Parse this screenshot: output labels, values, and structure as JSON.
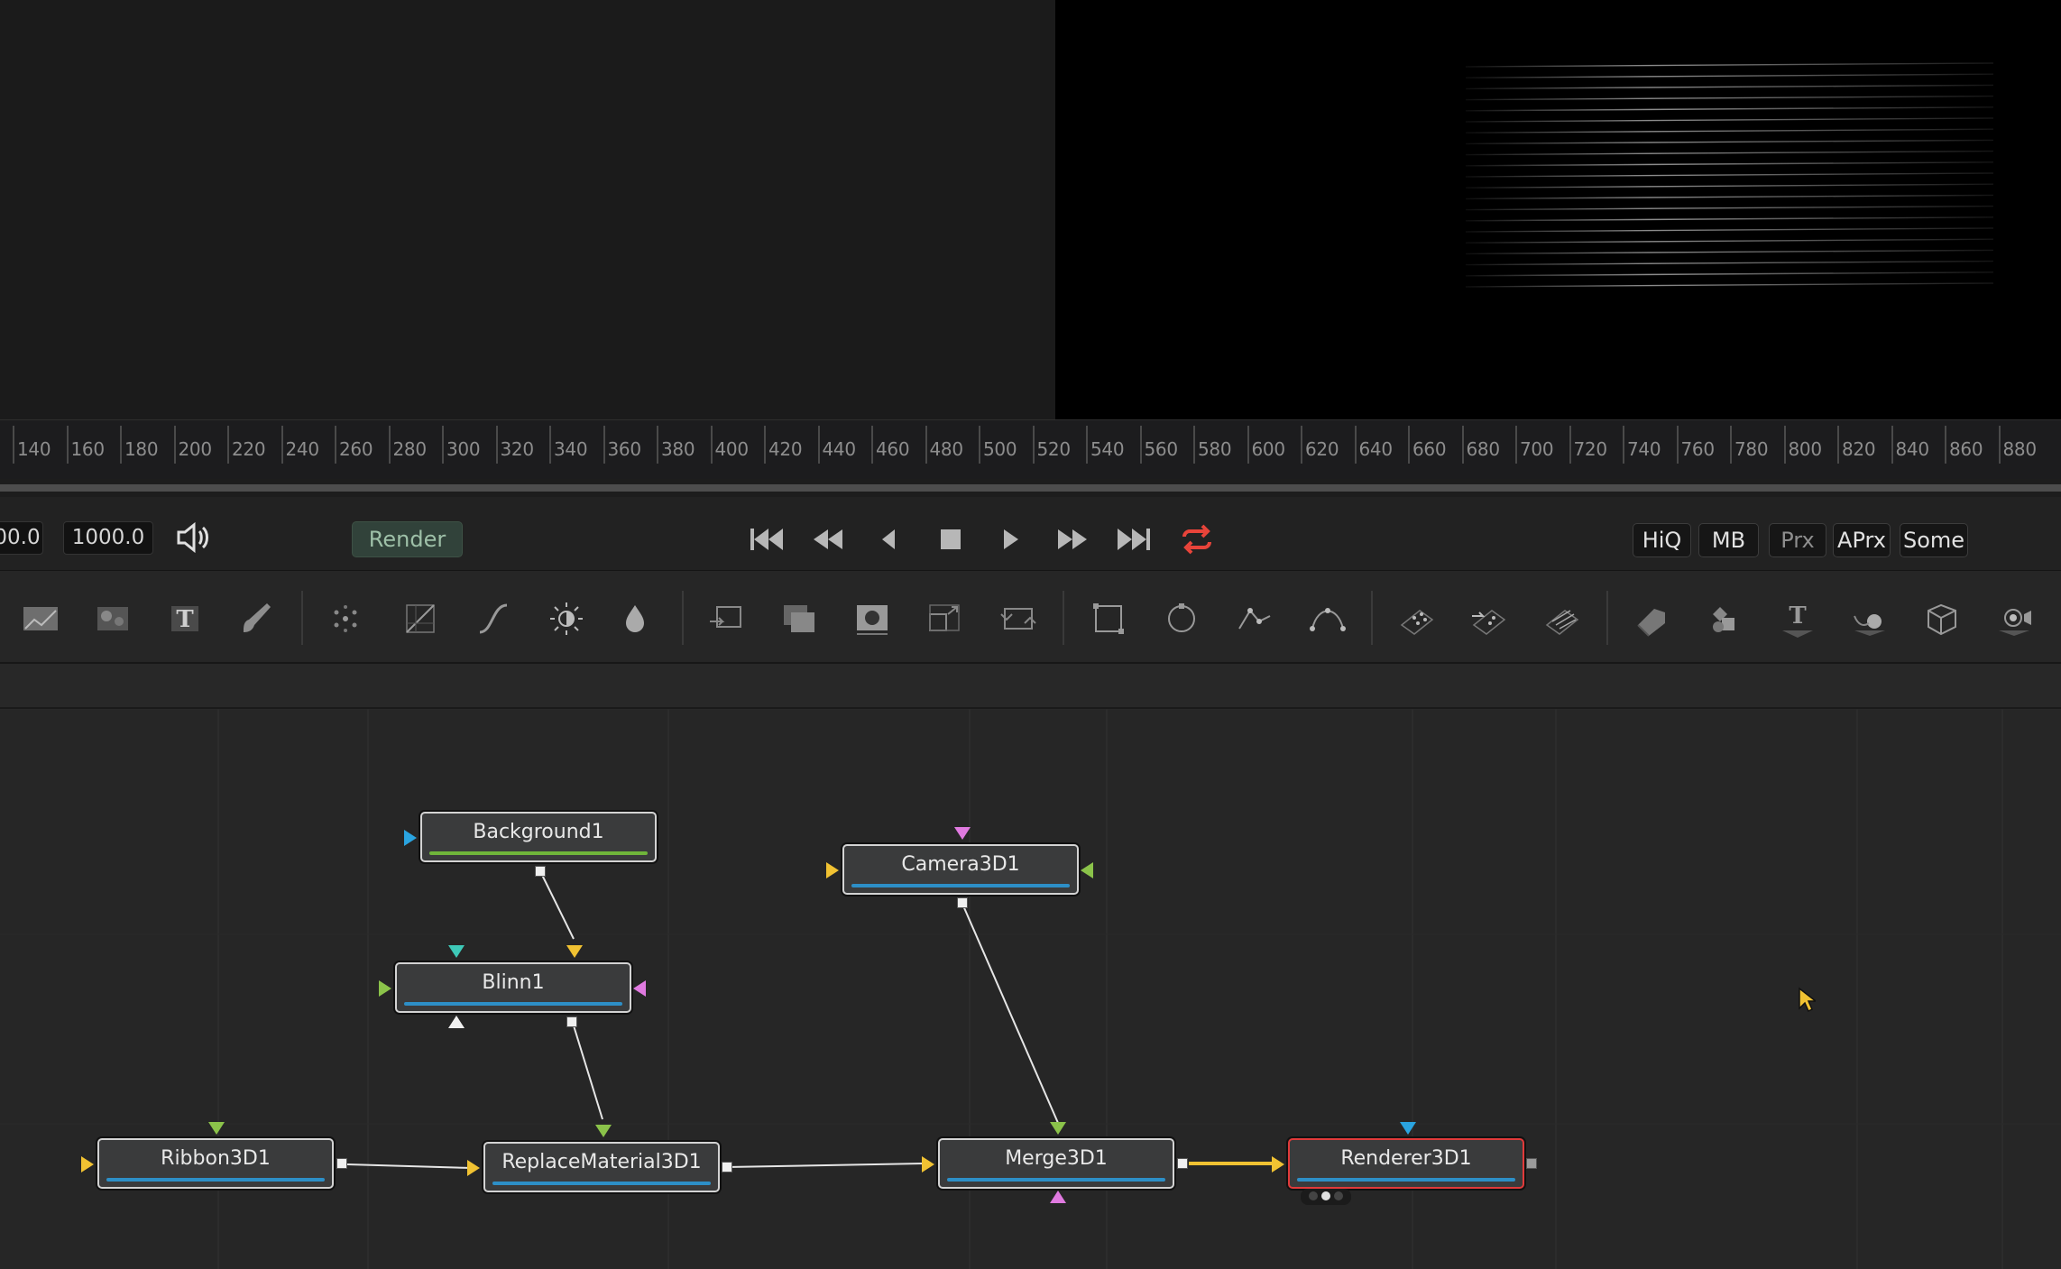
{
  "ruler": {
    "ticks": [
      "140",
      "160",
      "180",
      "200",
      "220",
      "240",
      "260",
      "280",
      "300",
      "320",
      "340",
      "360",
      "380",
      "400",
      "420",
      "440",
      "460",
      "480",
      "500",
      "520",
      "540",
      "560",
      "580",
      "600",
      "620",
      "640",
      "660",
      "680",
      "700",
      "720",
      "740",
      "760",
      "780",
      "800",
      "820",
      "840",
      "860",
      "880"
    ]
  },
  "transport": {
    "start_value": "00.0",
    "end_value": "1000.0",
    "render_label": "Render",
    "loop_color": "#e8443a",
    "quality_buttons": [
      "HiQ",
      "MB",
      "Prx",
      "APrx",
      "Some"
    ]
  },
  "toolbar": {
    "icons": [
      "background-icon",
      "fast-noise-icon",
      "text-plus-icon",
      "paint-icon",
      "particle-emitter-icon",
      "color-curves-icon",
      "brightness-contrast-icon",
      "color-corrector-icon",
      "blur-icon",
      "merge-icon",
      "channel-booleans-icon",
      "matte-control-icon",
      "resize-icon",
      "transform-icon",
      "rectangle-mask-icon",
      "ellipse-mask-icon",
      "polygon-mask-icon",
      "bspline-mask-icon",
      "particle-render-icon",
      "particle-spawn-icon",
      "particle-grid-icon",
      "shape3d-icon",
      "merge3d-icon",
      "text3d-icon",
      "renderer3d-icon",
      "camera3d-icon",
      "light-icon"
    ]
  },
  "nodes": {
    "background": "Background1",
    "blinn": "Blinn1",
    "camera": "Camera3D1",
    "ribbon": "Ribbon3D1",
    "replace_material": "ReplaceMaterial3D1",
    "merge": "Merge3D1",
    "renderer": "Renderer3D1"
  },
  "colors": {
    "node_bar_blue": "#2d8fc7",
    "node_bar_green": "#6fb53a",
    "selected_border": "#e13a3a",
    "wire_active": "#f1c232"
  }
}
